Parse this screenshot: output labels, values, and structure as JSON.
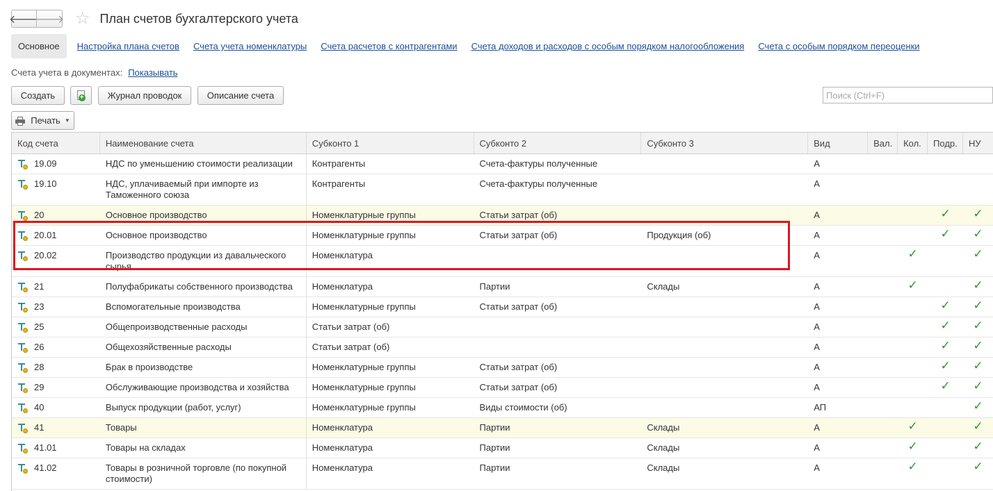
{
  "window": {
    "title": "План счетов бухгалтерского учета",
    "back_icon": "arrow-left-icon",
    "forward_icon": "arrow-right-icon",
    "favorite_icon": "star-icon"
  },
  "tabs": {
    "active": "Основное",
    "links": [
      "Настройка плана счетов",
      "Счета учета номенклатуры",
      "Счета расчетов с контрагентами",
      "Счета доходов и расходов с особым порядком налогообложения",
      "Счета с особым порядком переоценки"
    ]
  },
  "docs_accounts": {
    "label": "Счета учета в документах:",
    "link": "Показывать"
  },
  "toolbar": {
    "create": "Создать",
    "journal": "Журнал проводок",
    "description": "Описание счета",
    "print": "Печать",
    "search_placeholder": "Поиск (Ctrl+F)"
  },
  "columns": [
    "Код счета",
    "Наименование счета",
    "Субконто 1",
    "Субконто 2",
    "Субконто 3",
    "Вид",
    "Вал.",
    "Кол.",
    "Подр.",
    "НУ"
  ],
  "rows": [
    {
      "code": "19.09",
      "name": "НДС по уменьшению стоимости реализации",
      "s1": "Контрагенты",
      "s2": "Счета-фактуры полученные",
      "s3": "",
      "kind": "А",
      "val": false,
      "qty": false,
      "dep": false,
      "nu": false,
      "hl": false,
      "h": 29
    },
    {
      "code": "19.10",
      "name": "НДС, уплачиваемый при импорте из Таможенного союза",
      "s1": "Контрагенты",
      "s2": "Счета-фактуры полученные",
      "s3": "",
      "kind": "А",
      "val": false,
      "qty": false,
      "dep": false,
      "nu": false,
      "hl": false,
      "h": 45
    },
    {
      "code": "20",
      "name": "Основное производство",
      "s1": "Номенклатурные группы",
      "s2": "Статьи затрат (об)",
      "s3": "",
      "kind": "А",
      "val": false,
      "qty": false,
      "dep": true,
      "nu": true,
      "hl": true,
      "h": 29
    },
    {
      "code": "20.01",
      "name": "Основное производство",
      "s1": "Номенклатурные группы",
      "s2": "Статьи затрат (об)",
      "s3": "Продукция (об)",
      "kind": "А",
      "val": false,
      "qty": false,
      "dep": true,
      "nu": true,
      "hl": false,
      "h": 29
    },
    {
      "code": "20.02",
      "name": "Производство продукции из давальческого сырья",
      "s1": "Номенклатура",
      "s2": "",
      "s3": "",
      "kind": "А",
      "val": false,
      "qty": true,
      "dep": false,
      "nu": true,
      "hl": false,
      "h": 45
    },
    {
      "code": "21",
      "name": "Полуфабрикаты собственного производства",
      "s1": "Номенклатура",
      "s2": "Партии",
      "s3": "Склады",
      "kind": "А",
      "val": false,
      "qty": true,
      "dep": false,
      "nu": true,
      "hl": false,
      "h": 29
    },
    {
      "code": "23",
      "name": "Вспомогательные производства",
      "s1": "Номенклатурные группы",
      "s2": "Статьи затрат (об)",
      "s3": "",
      "kind": "А",
      "val": false,
      "qty": false,
      "dep": true,
      "nu": true,
      "hl": false,
      "h": 29
    },
    {
      "code": "25",
      "name": "Общепроизводственные расходы",
      "s1": "Статьи затрат (об)",
      "s2": "",
      "s3": "",
      "kind": "А",
      "val": false,
      "qty": false,
      "dep": true,
      "nu": true,
      "hl": false,
      "h": 29
    },
    {
      "code": "26",
      "name": "Общехозяйственные расходы",
      "s1": "Статьи затрат (об)",
      "s2": "",
      "s3": "",
      "kind": "А",
      "val": false,
      "qty": false,
      "dep": true,
      "nu": true,
      "hl": false,
      "h": 29
    },
    {
      "code": "28",
      "name": "Брак в производстве",
      "s1": "Номенклатурные группы",
      "s2": "Статьи затрат (об)",
      "s3": "",
      "kind": "А",
      "val": false,
      "qty": false,
      "dep": true,
      "nu": true,
      "hl": false,
      "h": 29
    },
    {
      "code": "29",
      "name": "Обслуживающие производства и хозяйства",
      "s1": "Номенклатурные группы",
      "s2": "Статьи затрат (об)",
      "s3": "",
      "kind": "А",
      "val": false,
      "qty": false,
      "dep": true,
      "nu": true,
      "hl": false,
      "h": 29
    },
    {
      "code": "40",
      "name": "Выпуск продукции (работ, услуг)",
      "s1": "Номенклатурные группы",
      "s2": "Виды стоимости (об)",
      "s3": "",
      "kind": "АП",
      "val": false,
      "qty": false,
      "dep": false,
      "nu": true,
      "hl": false,
      "h": 29
    },
    {
      "code": "41",
      "name": "Товары",
      "s1": "Номенклатура",
      "s2": "Партии",
      "s3": "Склады",
      "kind": "А",
      "val": false,
      "qty": true,
      "dep": false,
      "nu": true,
      "hl": true,
      "h": 29
    },
    {
      "code": "41.01",
      "name": "Товары на складах",
      "s1": "Номенклатура",
      "s2": "Партии",
      "s3": "Склады",
      "kind": "А",
      "val": false,
      "qty": true,
      "dep": false,
      "nu": true,
      "hl": false,
      "h": 29
    },
    {
      "code": "41.02",
      "name": "Товары в розничной торговле (по покупной стоимости)",
      "s1": "Номенклатура",
      "s2": "Партии",
      "s3": "Склады",
      "kind": "А",
      "val": false,
      "qty": true,
      "dep": false,
      "nu": true,
      "hl": false,
      "h": 45
    }
  ],
  "icons": {
    "account": "account-icon",
    "check": "check-icon",
    "printer": "printer-icon",
    "copy": "copy-icon"
  },
  "colors": {
    "link": "#1c4e9b",
    "check": "#2a9a2a",
    "highlight_frame": "#e0141e",
    "row_highlight": "#fbfbe6"
  }
}
